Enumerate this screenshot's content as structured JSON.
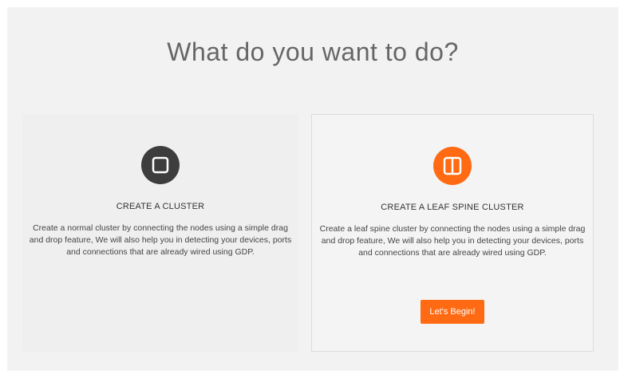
{
  "page": {
    "title": "What do you want to do?"
  },
  "cards": [
    {
      "icon": "square-icon",
      "icon_color": "#3d3d3d",
      "heading": "CREATE A CLUSTER",
      "description": "Create a normal cluster by connecting the nodes using a simple drag and drop feature, We will also help you in detecting your devices, ports and connections that are already wired using GDP."
    },
    {
      "icon": "split-square-icon",
      "icon_color": "#ff6a13",
      "heading": "CREATE A LEAF SPINE CLUSTER",
      "description": "Create a leaf spine cluster by connecting the nodes using a simple drag and drop feature, We will also help you in detecting your devices, ports and connections that are already wired using GDP.",
      "button_label": "Let's Begin!"
    }
  ],
  "colors": {
    "accent": "#ff6a13",
    "dark_icon": "#3d3d3d",
    "panel_background": "#f2f2f2"
  }
}
